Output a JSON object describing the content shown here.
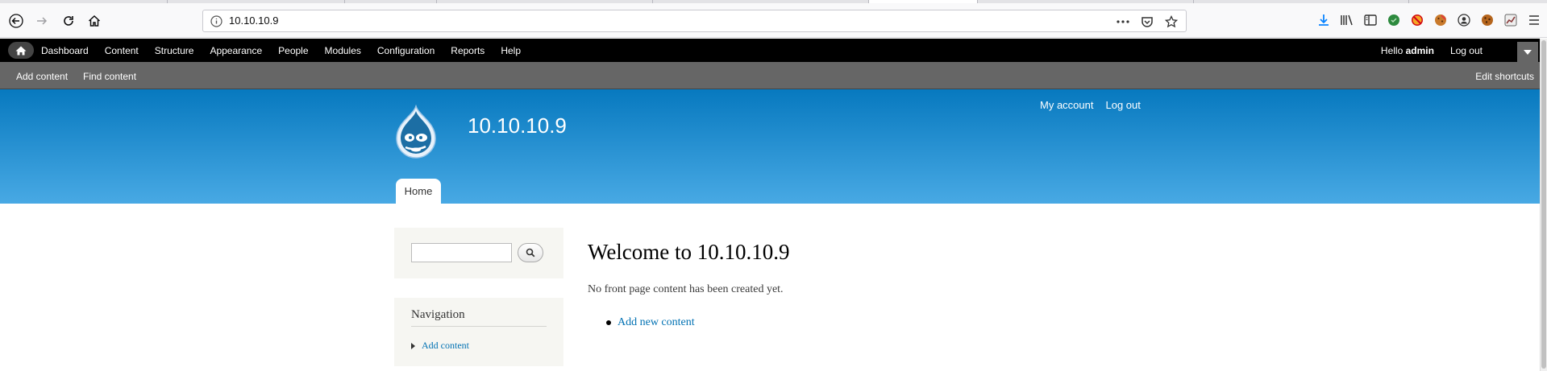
{
  "browser": {
    "url": "10.10.10.9"
  },
  "admin_toolbar": {
    "menu": [
      "Dashboard",
      "Content",
      "Structure",
      "Appearance",
      "People",
      "Modules",
      "Configuration",
      "Reports",
      "Help"
    ],
    "hello_prefix": "Hello",
    "username": "admin",
    "logout": "Log out"
  },
  "shortcuts": {
    "add_content": "Add content",
    "find_content": "Find content",
    "edit_shortcuts": "Edit shortcuts"
  },
  "header": {
    "site_name": "10.10.10.9",
    "my_account": "My account",
    "log_out": "Log out",
    "home_tab": "Home"
  },
  "sidebar": {
    "navigation_title": "Navigation",
    "navigation_items": [
      "Add content"
    ]
  },
  "main": {
    "title": "Welcome to 10.10.10.9",
    "message": "No front page content has been created yet.",
    "link": "Add new content"
  },
  "colors": {
    "header_top": "#0779bf",
    "header_bottom": "#48a9e4",
    "link": "#0071b3"
  }
}
